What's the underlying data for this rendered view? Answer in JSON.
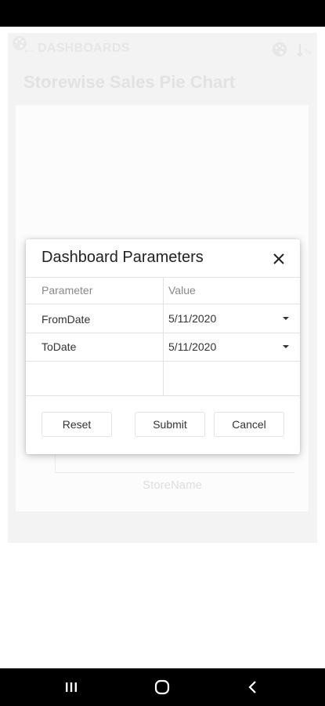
{
  "background": {
    "back_label": "DASHBOARDS",
    "page_title": "Storewise Sales Pie Chart",
    "x_axis_label": "StoreName"
  },
  "dialog": {
    "title": "Dashboard Parameters",
    "columns": [
      "Parameter",
      "Value"
    ],
    "rows": [
      {
        "parameter": "FromDate",
        "value": "5/11/2020"
      },
      {
        "parameter": "ToDate",
        "value": "5/11/2020"
      }
    ],
    "buttons": {
      "reset": "Reset",
      "submit": "Submit",
      "cancel": "Cancel"
    }
  },
  "icons": [
    "palette-icon",
    "back-arrow-icon",
    "sort-icon",
    "close-icon",
    "dropdown-caret-icon",
    "recents-icon",
    "home-icon",
    "back-icon"
  ]
}
